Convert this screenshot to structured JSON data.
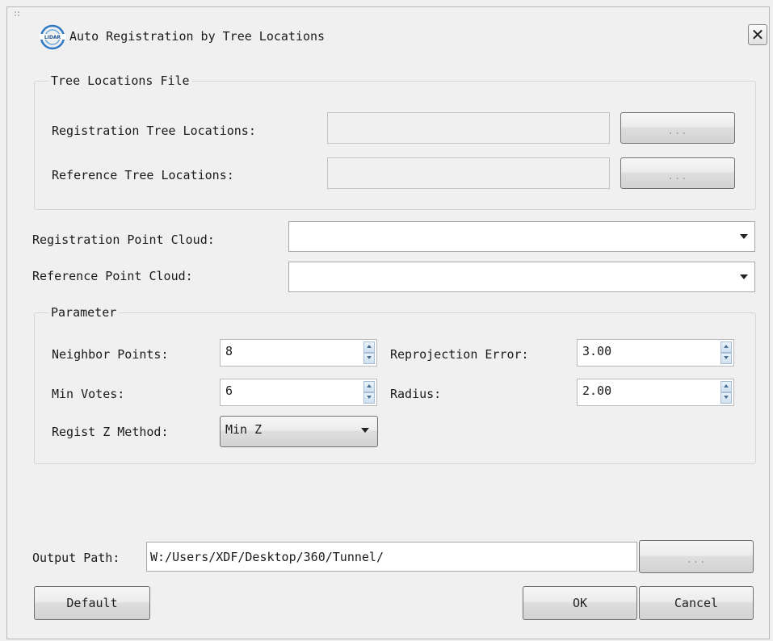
{
  "dialog": {
    "title": "Auto Registration by Tree Locations",
    "close_glyph": "✕"
  },
  "tree_locations_group": {
    "title": "Tree Locations File",
    "registration_label": "Registration Tree Locations:",
    "registration_value": "",
    "reference_label": "Reference Tree Locations:",
    "reference_value": "",
    "browse_label": "..."
  },
  "registration_point_cloud": {
    "label": "Registration Point Cloud:",
    "value": ""
  },
  "reference_point_cloud": {
    "label": "Reference Point Cloud:",
    "value": ""
  },
  "parameter_group": {
    "title": "Parameter",
    "neighbor_points": {
      "label": "Neighbor Points:",
      "value": "8"
    },
    "min_votes": {
      "label": "Min Votes:",
      "value": "6"
    },
    "reprojection_error": {
      "label": "Reprojection Error:",
      "value": "3.00"
    },
    "radius": {
      "label": "Radius:",
      "value": "2.00"
    },
    "regist_z_method": {
      "label": "Regist Z Method:",
      "value": "Min Z"
    }
  },
  "output": {
    "label": "Output Path:",
    "value": "W:/Users/XDF/Desktop/360/Tunnel/",
    "browse_label": "..."
  },
  "buttons": {
    "default": "Default",
    "ok": "OK",
    "cancel": "Cancel"
  },
  "icons": {
    "logo": "app-logo-icon",
    "close": "close-icon",
    "dropdown": "chevron-down-icon",
    "spin": "spin-arrows-icon"
  },
  "colors": {
    "window_bg": "#f0f0f0",
    "field_bg": "#ffffff",
    "logo_blue": "#2f78c4"
  }
}
